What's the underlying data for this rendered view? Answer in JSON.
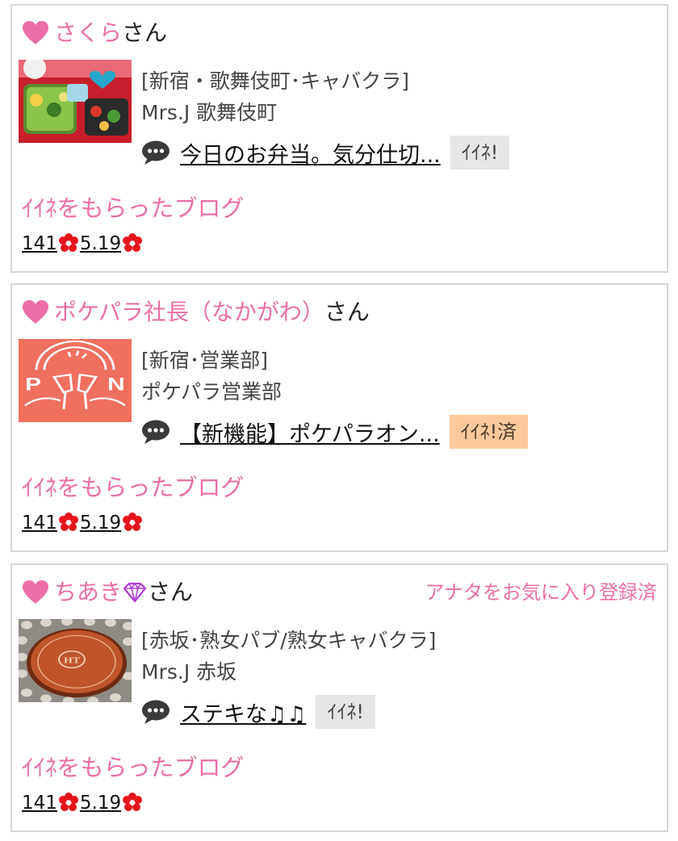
{
  "cards": [
    {
      "username": "さくら",
      "suffix": "さん",
      "category": "[新宿・歌舞伎町･キャバクラ]",
      "shop": "Mrs.J 歌舞伎町",
      "blog_title": "今日のお弁当。気分仕切...",
      "like_label": "ｲｲﾈ!",
      "liked_blog_label": "ｲｲﾈをもらったブログ",
      "stat_count": "141",
      "stat_date": "5.19"
    },
    {
      "username": "ポケパラ社長（なかがわ）",
      "suffix": "さん",
      "category": "[新宿･営業部]",
      "shop": "ポケパラ営業部",
      "blog_title": "【新機能】ポケパラオン...",
      "like_label": "ｲｲﾈ!済",
      "liked_blog_label": "ｲｲﾈをもらったブログ",
      "stat_count": "141",
      "stat_date": "5.19"
    },
    {
      "username": "ちあき",
      "suffix": "さん",
      "favorite_note": "アナタをお気に入り登録済",
      "category": "[赤坂･熟女パブ/熟女キャバクラ]",
      "shop": "Mrs.J 赤坂",
      "blog_title": "ステキな♫♫",
      "like_label": "ｲｲﾈ!",
      "liked_blog_label": "ｲｲﾈをもらったブログ",
      "stat_count": "141",
      "stat_date": "5.19"
    }
  ],
  "colors": {
    "accent_pink": "#ec6fa7",
    "like_done_bg": "#fcc99a",
    "like_bg": "#e6e6e6",
    "flower_red": "#e8141b"
  },
  "icons": [
    "heart-icon",
    "speech-bubble-icon",
    "flower-icon",
    "diamond-icon"
  ]
}
